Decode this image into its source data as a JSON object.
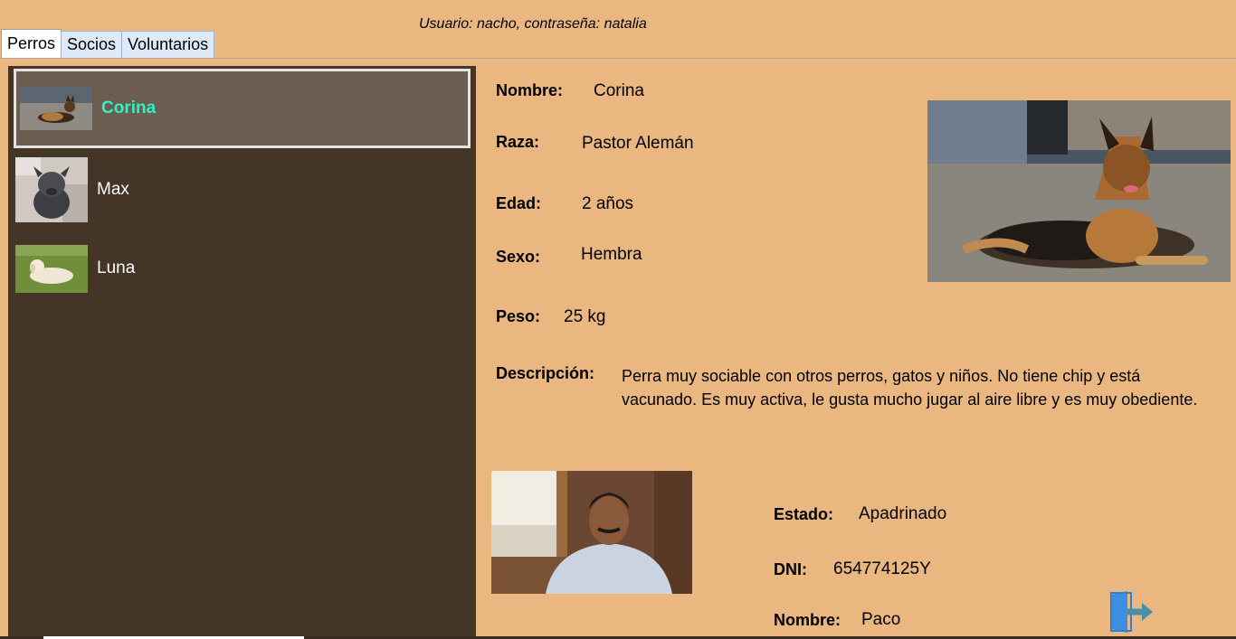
{
  "header": {
    "credentials": "Usuario: nacho, contraseña: natalia"
  },
  "tabs": [
    {
      "label": "Perros",
      "active": true
    },
    {
      "label": "Socios",
      "active": false
    },
    {
      "label": "Voluntarios",
      "active": false
    }
  ],
  "dogs": [
    {
      "name": "Corina",
      "selected": true
    },
    {
      "name": "Max",
      "selected": false
    },
    {
      "name": "Luna",
      "selected": false
    }
  ],
  "detail": {
    "nombre_label": "Nombre:",
    "nombre": "Corina",
    "raza_label": "Raza:",
    "raza": "Pastor Alemán",
    "edad_label": "Edad:",
    "edad": "2 años",
    "sexo_label": "Sexo:",
    "sexo": "Hembra",
    "peso_label": "Peso:",
    "peso": "25 kg",
    "descripcion_label": "Descripción:",
    "descripcion": "Perra muy sociable con otros perros, gatos y niños. No tiene chip y está vacunado. Es muy activa, le gusta mucho jugar al aire libre y es muy obediente."
  },
  "sponsor": {
    "estado_label": "Estado:",
    "estado": "Apadrinado",
    "dni_label": "DNI:",
    "dni": "654774125Y",
    "nombre_label": "Nombre:",
    "nombre": "Paco"
  },
  "icons": {
    "logout": "logout-icon"
  },
  "colors": {
    "background": "#e9b77f",
    "list_bg": "#443527",
    "selected_bg": "#6b5e50",
    "selected_text": "#2ff0c8"
  }
}
